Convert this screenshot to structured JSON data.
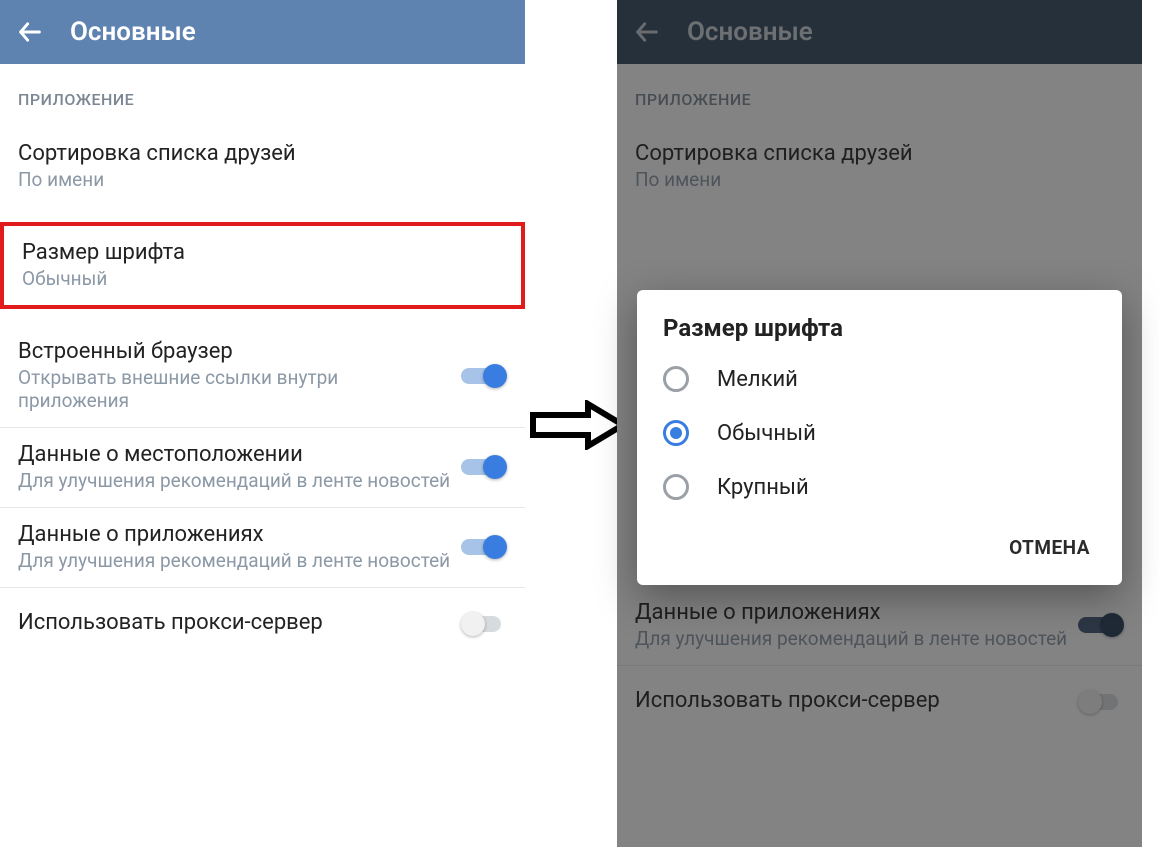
{
  "left": {
    "title": "Основные",
    "section": "ПРИЛОЖЕНИЕ",
    "rows": {
      "sort": {
        "title": "Сортировка списка друзей",
        "sub": "По имени"
      },
      "font": {
        "title": "Размер шрифта",
        "sub": "Обычный"
      },
      "browser": {
        "title": "Встроенный браузер",
        "sub": "Открывать внешние ссылки внутри приложения"
      },
      "geo": {
        "title": "Данные о местоположении",
        "sub": "Для улучшения рекомендаций в ленте новостей"
      },
      "apps": {
        "title": "Данные о приложениях",
        "sub": "Для улучшения рекомендаций в ленте новостей"
      },
      "proxy": {
        "title": "Использовать прокси-сервер"
      }
    }
  },
  "right": {
    "title": "Основные",
    "section": "ПРИЛОЖЕНИЕ",
    "rows": {
      "sort": {
        "title": "Сортировка списка друзей",
        "sub": "По имени"
      },
      "apps": {
        "title": "Данные о приложениях",
        "sub": "Для улучшения рекомендаций в ленте новостей"
      },
      "proxy": {
        "title": "Использовать прокси-сервер"
      }
    }
  },
  "dialog": {
    "title": "Размер шрифта",
    "options": [
      "Мелкий",
      "Обычный",
      "Крупный"
    ],
    "selected_index": 1,
    "cancel": "ОТМЕНА"
  }
}
